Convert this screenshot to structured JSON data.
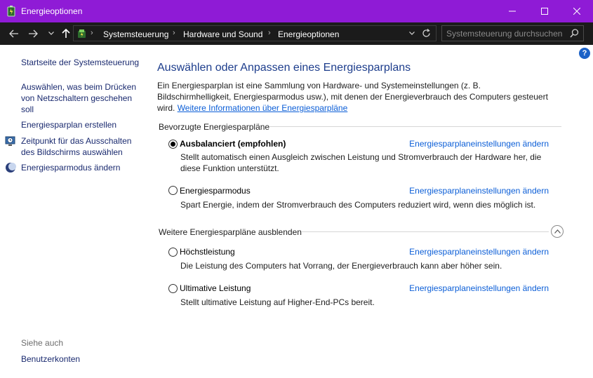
{
  "window": {
    "title": "Energieoptionen"
  },
  "address": {
    "crumbs": [
      "Systemsteuerung",
      "Hardware und Sound",
      "Energieoptionen"
    ],
    "search_placeholder": "Systemsteuerung durchsuchen"
  },
  "sidebar": {
    "home": "Startseite der Systemsteuerung",
    "tasks": [
      {
        "label": "Auswählen, was beim Drücken von Netzschaltern geschehen soll",
        "icon": null
      },
      {
        "label": "Energiesparplan erstellen",
        "icon": null
      },
      {
        "label": "Zeitpunkt für das Ausschalten des Bildschirms auswählen",
        "icon": "monitor-clock-icon"
      },
      {
        "label": "Energiesparmodus ändern",
        "icon": "moon-icon"
      }
    ],
    "see_also": "Siehe auch",
    "see_also_items": [
      "Benutzerkonten"
    ]
  },
  "main": {
    "heading": "Auswählen oder Anpassen eines Energiesparplans",
    "intro": "Ein Energiesparplan ist eine Sammlung von Hardware- und Systemeinstellungen (z. B. Bildschirmhelligkeit, Energiesparmodus usw.), mit denen der Energieverbrauch des Computers gesteuert wird.",
    "intro_link": "Weitere Informationen über Energiesparpläne",
    "preferred_header": "Bevorzugte Energiesparpläne",
    "more_header": "Weitere Energiesparpläne ausblenden",
    "change_link": "Energiesparplaneinstellungen ändern",
    "plans": [
      {
        "name": "Ausbalanciert (empfohlen)",
        "selected": true,
        "desc": "Stellt automatisch einen Ausgleich zwischen Leistung und Stromverbrauch der Hardware her, die diese Funktion unterstützt."
      },
      {
        "name": "Energiesparmodus",
        "selected": false,
        "desc": "Spart Energie, indem der Stromverbrauch des Computers reduziert wird, wenn dies möglich ist."
      },
      {
        "name": "Höchstleistung",
        "selected": false,
        "desc": "Die Leistung des Computers hat Vorrang, der Energieverbrauch kann aber höher sein."
      },
      {
        "name": "Ultimative Leistung",
        "selected": false,
        "desc": "Stellt ultimative Leistung auf Higher-End-PCs bereit."
      }
    ]
  },
  "help": "?"
}
